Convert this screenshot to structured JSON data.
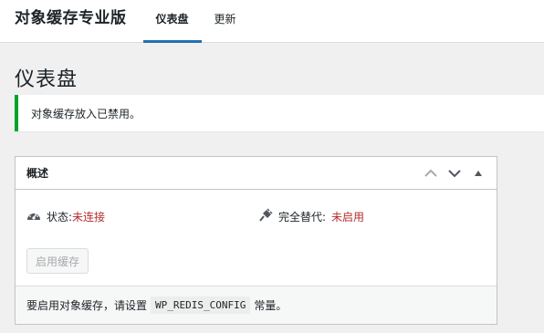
{
  "header": {
    "plugin_title": "对象缓存专业版",
    "tabs": [
      {
        "label": "仪表盘",
        "active": true
      },
      {
        "label": "更新",
        "active": false
      }
    ]
  },
  "page_title": "仪表盘",
  "notice": {
    "text": "对象缓存放入已禁用。",
    "accent_color": "#00a32a"
  },
  "overview": {
    "title": "概述",
    "status_label": "状态:",
    "status_value": "未连接",
    "dropin_label": "完全替代:",
    "dropin_value": "未启用",
    "enable_button": "启用缓存",
    "footer_before": "要启用对象缓存，请设置",
    "footer_code": "WP_REDIS_CONFIG",
    "footer_after": "常量。",
    "error_color": "#b32d2e"
  }
}
